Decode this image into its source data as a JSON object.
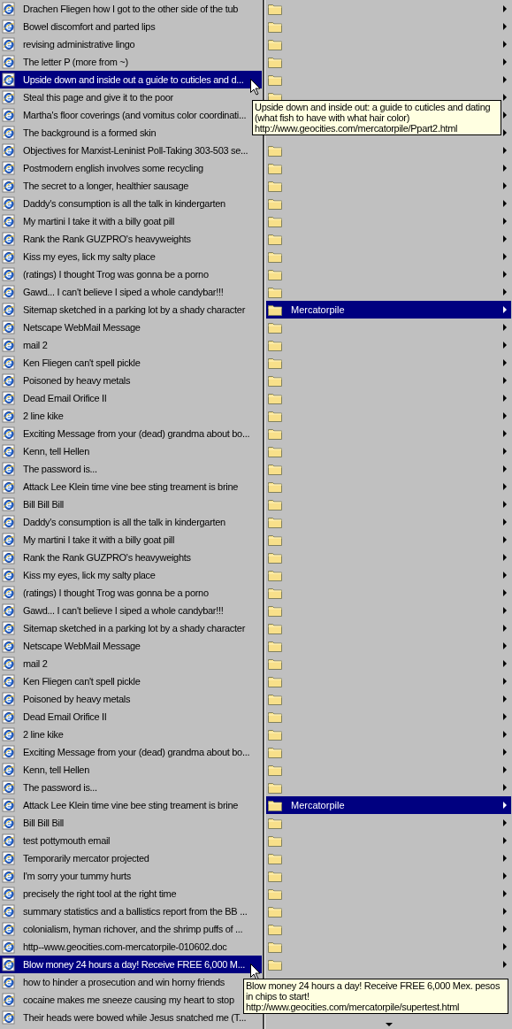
{
  "favorites": {
    "items": [
      {
        "title": "Drachen Fliegen how I got to the other side of the tub",
        "selected": false
      },
      {
        "title": "Bowel discomfort and parted lips",
        "selected": false
      },
      {
        "title": "revising administrative lingo",
        "selected": false
      },
      {
        "title": "The letter P (more from ~)",
        "selected": false
      },
      {
        "title": "Upside down and inside out a guide to cuticles and d...",
        "selected": true,
        "tooltip": {
          "text": "Upside down and inside out: a guide to cuticles and dating (what fish to have with what hair color)",
          "url": "http://www.geocities.com/mercatorpile/Ppart2.html"
        }
      },
      {
        "title": "Steal this page and give it to the poor",
        "selected": false
      },
      {
        "title": "Martha's floor coverings (and vomitus color coordinati...",
        "selected": false
      },
      {
        "title": "The background is a formed skin",
        "selected": false
      },
      {
        "title": "Objectives for Marxist-Leninist Poll-Taking 303-503 se...",
        "selected": false
      },
      {
        "title": "Postmodern english involves some recycling",
        "selected": false
      },
      {
        "title": "The secret to a longer, healthier sausage",
        "selected": false
      },
      {
        "title": "Daddy's consumption is all the talk in kindergarten",
        "selected": false
      },
      {
        "title": "My martini I take it with a billy goat pill",
        "selected": false
      },
      {
        "title": "Rank the Rank GUZPRO's heavyweights",
        "selected": false
      },
      {
        "title": "Kiss my eyes, lick my salty place",
        "selected": false
      },
      {
        "title": "(ratings) I thought Trog was gonna be a porno",
        "selected": false
      },
      {
        "title": "Gawd... I can't believe I siped a whole candybar!!!",
        "selected": false
      },
      {
        "title": "Sitemap sketched in a parking lot by a shady character",
        "selected": false
      },
      {
        "title": "Netscape WebMail Message",
        "selected": false
      },
      {
        "title": "mail 2",
        "selected": false
      },
      {
        "title": "Ken Fliegen can't spell pickle",
        "selected": false
      },
      {
        "title": "Poisoned by heavy metals",
        "selected": false
      },
      {
        "title": "Dead Email Orifice II",
        "selected": false
      },
      {
        "title": "2 line kike",
        "selected": false
      },
      {
        "title": "Exciting Message from your (dead) grandma about bo...",
        "selected": false
      },
      {
        "title": "Kenn, tell Hellen",
        "selected": false
      },
      {
        "title": "The password is...",
        "selected": false
      },
      {
        "title": "Attack Lee Klein time vine bee sting treament is brine",
        "selected": false
      },
      {
        "title": "Bill Bill Bill",
        "selected": false
      },
      {
        "title": "Daddy's consumption is all the talk in kindergarten",
        "selected": false
      },
      {
        "title": "My martini I take it with a billy goat pill",
        "selected": false
      },
      {
        "title": "Rank the Rank GUZPRO's heavyweights",
        "selected": false
      },
      {
        "title": "Kiss my eyes, lick my salty place",
        "selected": false
      },
      {
        "title": "(ratings) I thought Trog was gonna be a porno",
        "selected": false
      },
      {
        "title": "Gawd... I can't believe I siped a whole candybar!!!",
        "selected": false
      },
      {
        "title": "Sitemap sketched in a parking lot by a shady character",
        "selected": false
      },
      {
        "title": "Netscape WebMail Message",
        "selected": false
      },
      {
        "title": "mail 2",
        "selected": false
      },
      {
        "title": "Ken Fliegen can't spell pickle",
        "selected": false
      },
      {
        "title": "Poisoned by heavy metals",
        "selected": false
      },
      {
        "title": "Dead Email Orifice II",
        "selected": false
      },
      {
        "title": "2 line kike",
        "selected": false
      },
      {
        "title": "Exciting Message from your (dead) grandma about bo...",
        "selected": false
      },
      {
        "title": "Kenn, tell Hellen",
        "selected": false
      },
      {
        "title": "The password is...",
        "selected": false
      },
      {
        "title": "Attack Lee Klein time vine bee sting treament is brine",
        "selected": false
      },
      {
        "title": "Bill Bill Bill",
        "selected": false
      },
      {
        "title": "test  pottymouth email",
        "selected": false
      },
      {
        "title": "Temporarily mercator projected",
        "selected": false
      },
      {
        "title": "I'm sorry your tummy hurts",
        "selected": false
      },
      {
        "title": "precisely the right tool at the right time",
        "selected": false
      },
      {
        "title": "summary statistics and a ballistics report from the BB ...",
        "selected": false
      },
      {
        "title": "colonialism, hyman richover, and the shrimp puffs of ...",
        "selected": false
      },
      {
        "title": "http--www.geocities.com-mercatorpile-010602.doc",
        "selected": false
      },
      {
        "title": "Blow money 24 hours a day! Receive FREE 6,000 M...",
        "selected": true,
        "tooltip": {
          "text": "Blow money 24 hours a day! Receive FREE 6,000 Mex. pesos in chips to start!",
          "url": "http://www.geocities.com/mercatorpile/supertest.html"
        }
      },
      {
        "title": "how to hinder a prosecution and win horny friends",
        "selected": false
      },
      {
        "title": "cocaine makes me sneeze causing my heart to stop",
        "selected": false
      },
      {
        "title": "Their heads were bowed while Jesus snatched me (T...",
        "selected": false
      }
    ]
  },
  "folder_menu": {
    "items": [
      {
        "selected": false
      },
      {
        "selected": false
      },
      {
        "selected": false
      },
      {
        "selected": false
      },
      {
        "selected": false
      },
      {
        "selected": false
      },
      {
        "selected": false
      },
      {
        "selected": false
      },
      {
        "selected": false
      },
      {
        "selected": false
      },
      {
        "selected": false
      },
      {
        "selected": false
      },
      {
        "selected": false
      },
      {
        "selected": false
      },
      {
        "selected": false
      },
      {
        "selected": false
      },
      {
        "selected": false
      },
      {
        "selected": true,
        "label": "Mercatorpile"
      },
      {
        "selected": false
      },
      {
        "selected": false
      },
      {
        "selected": false
      },
      {
        "selected": false
      },
      {
        "selected": false
      },
      {
        "selected": false
      },
      {
        "selected": false
      },
      {
        "selected": false
      },
      {
        "selected": false
      },
      {
        "selected": false
      },
      {
        "selected": false
      },
      {
        "selected": false
      },
      {
        "selected": false
      },
      {
        "selected": false
      },
      {
        "selected": false
      },
      {
        "selected": false
      },
      {
        "selected": false
      },
      {
        "selected": false
      },
      {
        "selected": false
      },
      {
        "selected": false
      },
      {
        "selected": false
      },
      {
        "selected": false
      },
      {
        "selected": false
      },
      {
        "selected": false
      },
      {
        "selected": false
      },
      {
        "selected": false
      },
      {
        "selected": false
      },
      {
        "selected": true,
        "label": "Mercatorpile"
      },
      {
        "selected": false
      },
      {
        "selected": false
      },
      {
        "selected": false
      },
      {
        "selected": false
      },
      {
        "selected": false
      },
      {
        "selected": false
      },
      {
        "selected": false
      },
      {
        "selected": false
      },
      {
        "selected": false
      }
    ]
  }
}
